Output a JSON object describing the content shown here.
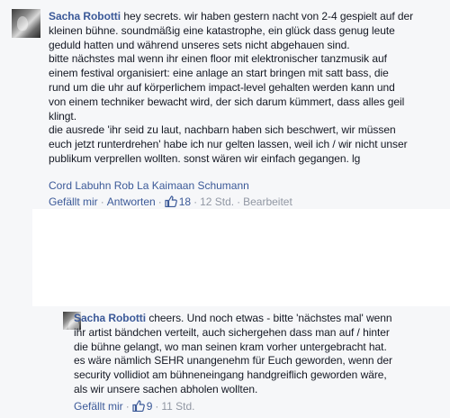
{
  "main_comment": {
    "author": "Sacha Robotti",
    "text": " hey secrets. wir haben gestern nacht von 2-4 gespielt auf der\nkleinen bühne. soundmäßig eine katastrophe, ein glück dass genug leute\ngeduld hatten und während unseres sets nicht abgehauen sind.\nbitte nächstes mal wenn ihr einen floor mit elektronischer tanzmusik auf\neinem festival organisiert: eine anlage an start bringen mit satt bass, die\nrund um die uhr auf körperlichem impact-level gehalten werden kann und\nvon einem techniker bewacht wird, der sich darum kümmert, dass alles geil\nklingt.\ndie ausrede 'ihr seid zu laut, nachbarn haben sich beschwert, wir müssen\neuch jetzt runterdrehen' habe ich nur gelten lassen, weil ich / wir nicht unser\npublikum verprellen wollten. sonst wären wir einfach gegangen. lg",
    "tags": "Cord Labuhn Rob La Kaimaan Schumann",
    "actions": {
      "like": "Gefällt mir",
      "reply": "Antworten",
      "like_count": "18",
      "time": "12 Std.",
      "edited": "Bearbeitet"
    }
  },
  "reply_comment": {
    "author": "Sacha Robotti",
    "text": " cheers. Und noch etwas - bitte 'nächstes mal' wenn\nihr artist bändchen verteilt, auch sichergehen dass man auf / hinter\ndie bühne gelangt, wo man seinen kram vorher untergebracht hat.\nes wäre nämlich SEHR unangenehm für Euch geworden, wenn der\nsecurity vollidiot am bühneneingang handgreiflich geworden wäre,\nals wir unsere sachen abholen wollten.",
    "actions": {
      "like": "Gefällt mir",
      "like_count": "9",
      "time": "11 Std."
    }
  },
  "colors": {
    "link": "#3b5998",
    "meta": "#9197a3",
    "text": "#141823",
    "background": "#f6f7f9"
  },
  "icons": {
    "like": "thumbs-up-icon"
  }
}
